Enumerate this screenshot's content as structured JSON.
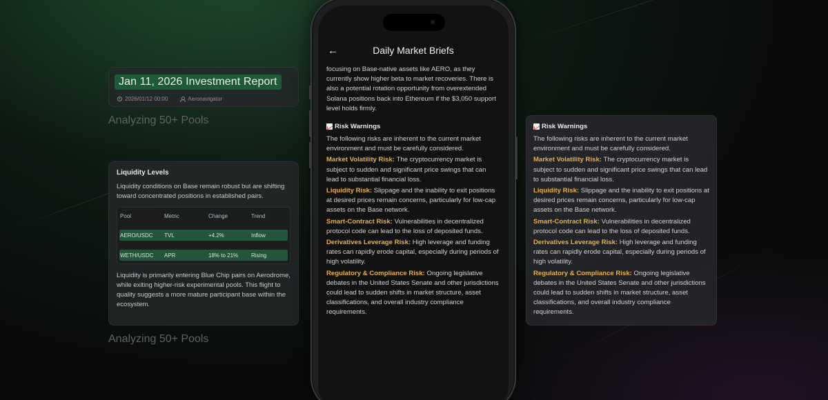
{
  "report": {
    "title": "Jan 11, 2026 Investment Report",
    "date": "2026/01/12 00:00",
    "author": "Aeronavigator"
  },
  "analyzing_labels": [
    "Analyzing 50+ Pools",
    "Analyzing 50+ Pools"
  ],
  "liquidity": {
    "heading": "Liquidity Levels",
    "intro": "Liquidity conditions on Base remain robust but are shifting toward concentrated positions in established pairs.",
    "table": {
      "headers": [
        "Pool",
        "Metric",
        "Change",
        "Trend"
      ],
      "rows": [
        [
          "AERO/USDC",
          "TVL",
          "+4.2%",
          "Inflow"
        ],
        [
          "WETH/USDC",
          "APR",
          "18% to 21%",
          "Rising"
        ]
      ]
    },
    "outro": "Liquidity is primarily entering Blue Chip pairs on Aerodrome, while exiting higher-risk experimental pools. This flight to quality suggests a more mature participant base within the ecosystem."
  },
  "phone": {
    "nav_title": "Daily Market Briefs",
    "intro_text": "focusing on Base-native assets like AERO, as they currently show higher beta to market recoveries. There is also a potential rotation opportunity from overextended Solana positions back into Ethereum if the $3,050 support level holds firmly."
  },
  "risk_warnings": {
    "heading": "Risk Warnings",
    "icon": "chart-increasing-icon",
    "intro": "The following risks are inherent to the current market environment and must be carefully considered.",
    "items": [
      {
        "name": "Market Volatility Risk:",
        "text": " The cryptocurrency market is subject to sudden and significant price swings that can lead to substantial financial loss."
      },
      {
        "name": "Liquidity Risk:",
        "text": " Slippage and the inability to exit positions at desired prices remain concerns, particularly for low-cap assets on the Base network."
      },
      {
        "name": "Smart-Contract Risk:",
        "text": " Vulnerabilities in decentralized protocol code can lead to the loss of deposited funds."
      },
      {
        "name": "Derivatives Leverage Risk:",
        "text": " High leverage and funding rates can rapidly erode capital, especially during periods of high volatility."
      },
      {
        "name": "Regulatory & Compliance Risk:",
        "text": " Ongoing legislative debates in the United States Senate and other jurisdictions could lead to sudden shifts in market structure, asset classifications, and overall industry compliance requirements."
      }
    ]
  },
  "colors": {
    "accent_green": "#1e5a36",
    "risk_label": "#e8b04a",
    "row_highlight": "#23553a"
  }
}
